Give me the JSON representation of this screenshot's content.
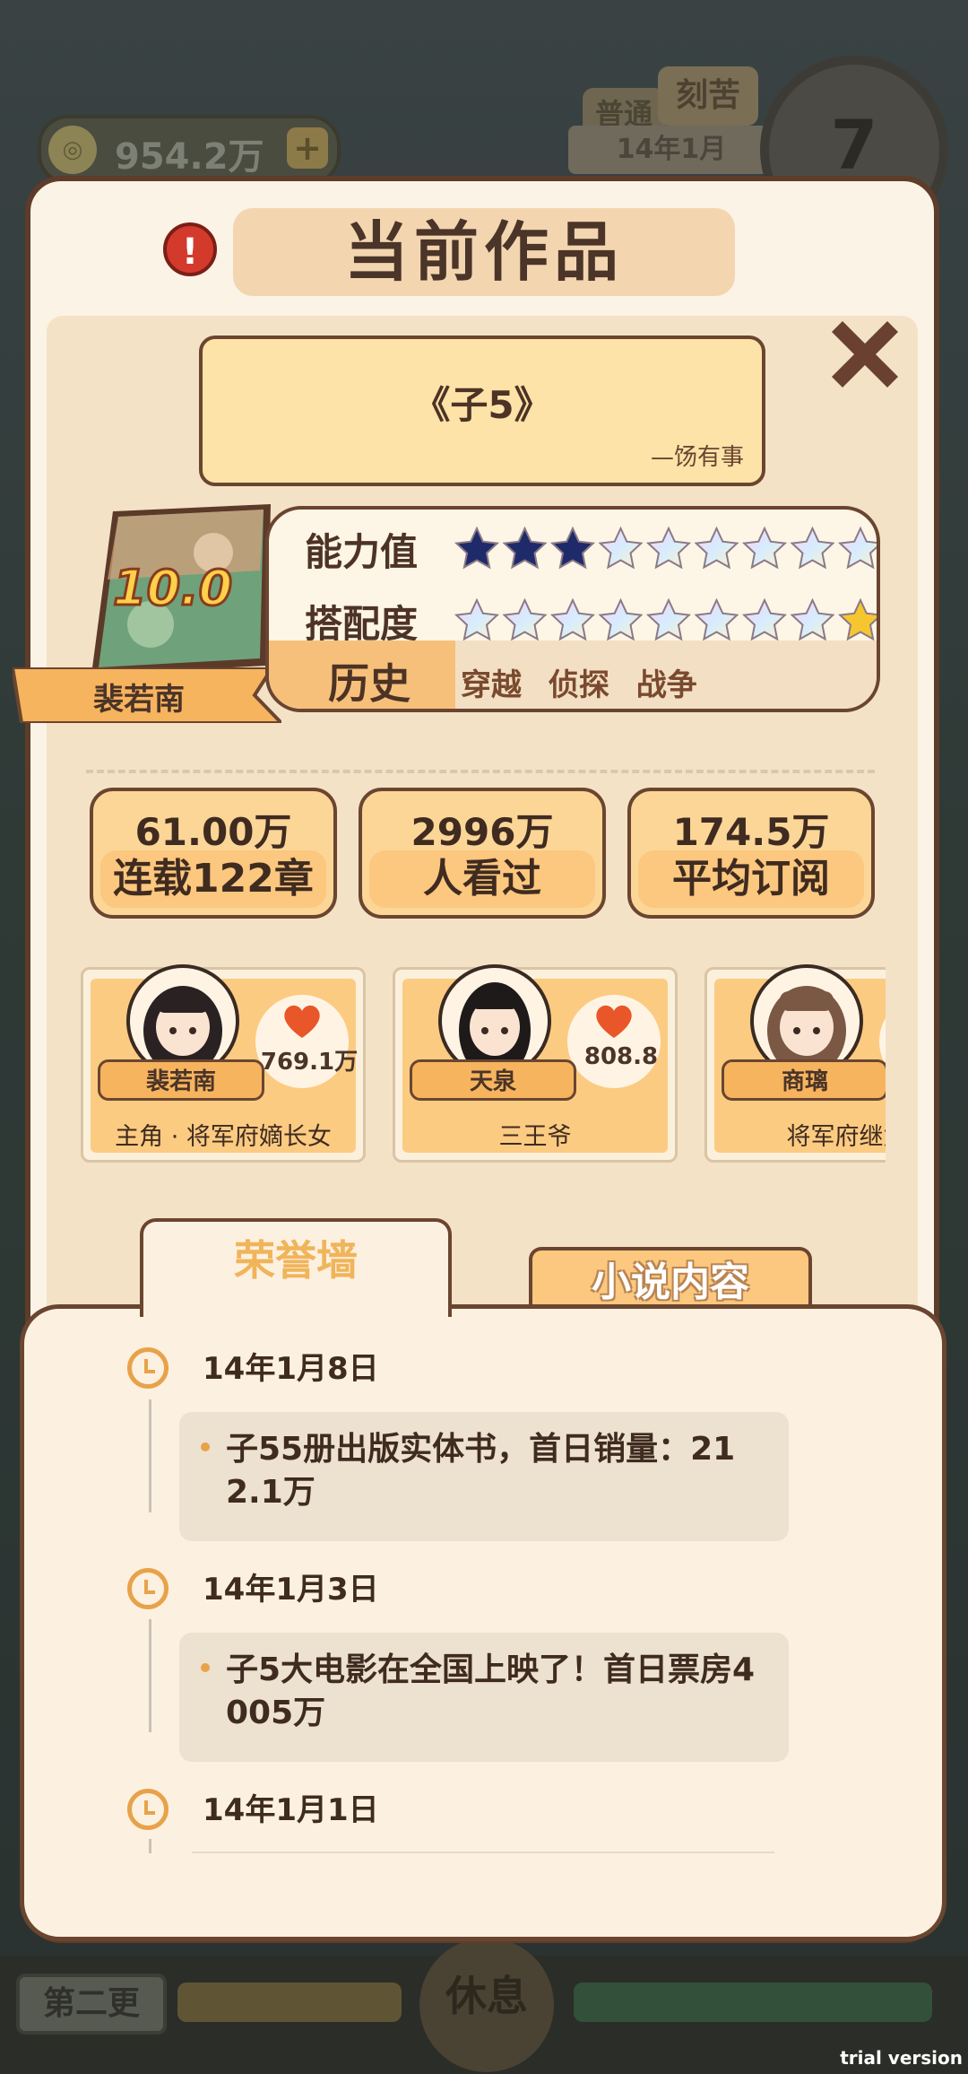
{
  "background": {
    "coins": "954.2万",
    "coin_plus": "+",
    "mode_normal": "普通",
    "mode_hard": "刻苦",
    "date": "14年1月",
    "clock_value": "7",
    "chapter_button": "第二更",
    "rest_button": "休息",
    "trial_label": "trial version"
  },
  "panel": {
    "title": "当前作品",
    "alert_symbol": "!",
    "book": {
      "title": "《子5》",
      "author": "—饧有事",
      "score": "10.0",
      "pen_name": "裴若南"
    },
    "attributes": {
      "ability_label": "能力值",
      "ability_stars": {
        "filled": 3,
        "total": 9
      },
      "match_label": "搭配度",
      "match_stars": {
        "filled": 0,
        "total": 9,
        "gold_last": true
      },
      "genre_label": "历史",
      "tags": [
        "穿越",
        "侦探",
        "战争"
      ]
    },
    "stats": [
      {
        "value": "61.00万",
        "label": "连载122章"
      },
      {
        "value": "2996万",
        "label": "人看过"
      },
      {
        "value": "174.5万",
        "label": "平均订阅"
      }
    ],
    "characters": [
      {
        "name": "裴若南",
        "affection": "769.1万",
        "role": "主角 · 将军府嫡长女",
        "hair": "#2a2222"
      },
      {
        "name": "天泉",
        "affection": "808.8",
        "role": "三王爷",
        "hair": "#1e1a1a"
      },
      {
        "name": "商璃",
        "affection": "",
        "role": "将军府继女",
        "hair": "#7a5844"
      }
    ],
    "tabs": {
      "honor": "荣誉墙",
      "novel": "小说内容"
    },
    "history": [
      {
        "date": "14年1月8日",
        "text": "子55册出版实体书，首日销量：212.1万"
      },
      {
        "date": "14年1月3日",
        "text": "子5大电影在全国上映了！首日票房4005万"
      },
      {
        "date": "14年1月1日",
        "text": ""
      }
    ]
  },
  "colors": {
    "panel_border": "#5e3c2a",
    "accent_orange": "#f7b45e",
    "star_filled": "#1f2a6b",
    "star_gold": "#f6c630"
  }
}
